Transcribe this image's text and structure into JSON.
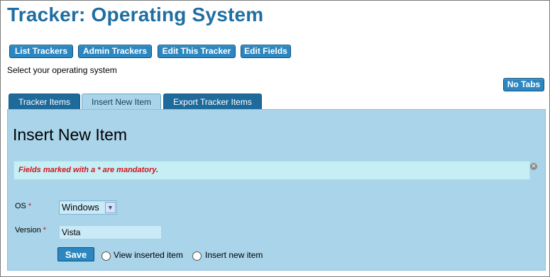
{
  "page": {
    "title": "Tracker: Operating System",
    "description": "Select your operating system"
  },
  "toolbar": {
    "buttons": [
      {
        "label": "List Trackers"
      },
      {
        "label": "Admin Trackers"
      },
      {
        "label": "Edit This Tracker"
      },
      {
        "label": "Edit Fields"
      }
    ],
    "no_tabs_label": "No Tabs"
  },
  "tabs": [
    {
      "label": "Tracker Items",
      "active": false
    },
    {
      "label": "Insert New Item",
      "active": true
    },
    {
      "label": "Export Tracker Items",
      "active": false
    }
  ],
  "panel": {
    "heading": "Insert New Item",
    "mandatory_notice": "Fields marked with a * are mandatory.",
    "close_icon": "close-circle-icon",
    "fields": {
      "os": {
        "label": "OS",
        "required_marker": "*",
        "selected_value": "Windows"
      },
      "version": {
        "label": "Version",
        "required_marker": "*",
        "value": "Vista"
      }
    },
    "save_label": "Save",
    "after_save_options": [
      {
        "label": "View inserted item",
        "checked": false
      },
      {
        "label": "Insert new item",
        "checked": false
      }
    ]
  },
  "colors": {
    "title": "#1f6ea3",
    "button": "#2c87c1",
    "tab_inactive": "#1d6a9b",
    "panel": "#a9d4e9",
    "notice_bg": "#c5eef5",
    "mandatory_text": "#d4141c"
  }
}
